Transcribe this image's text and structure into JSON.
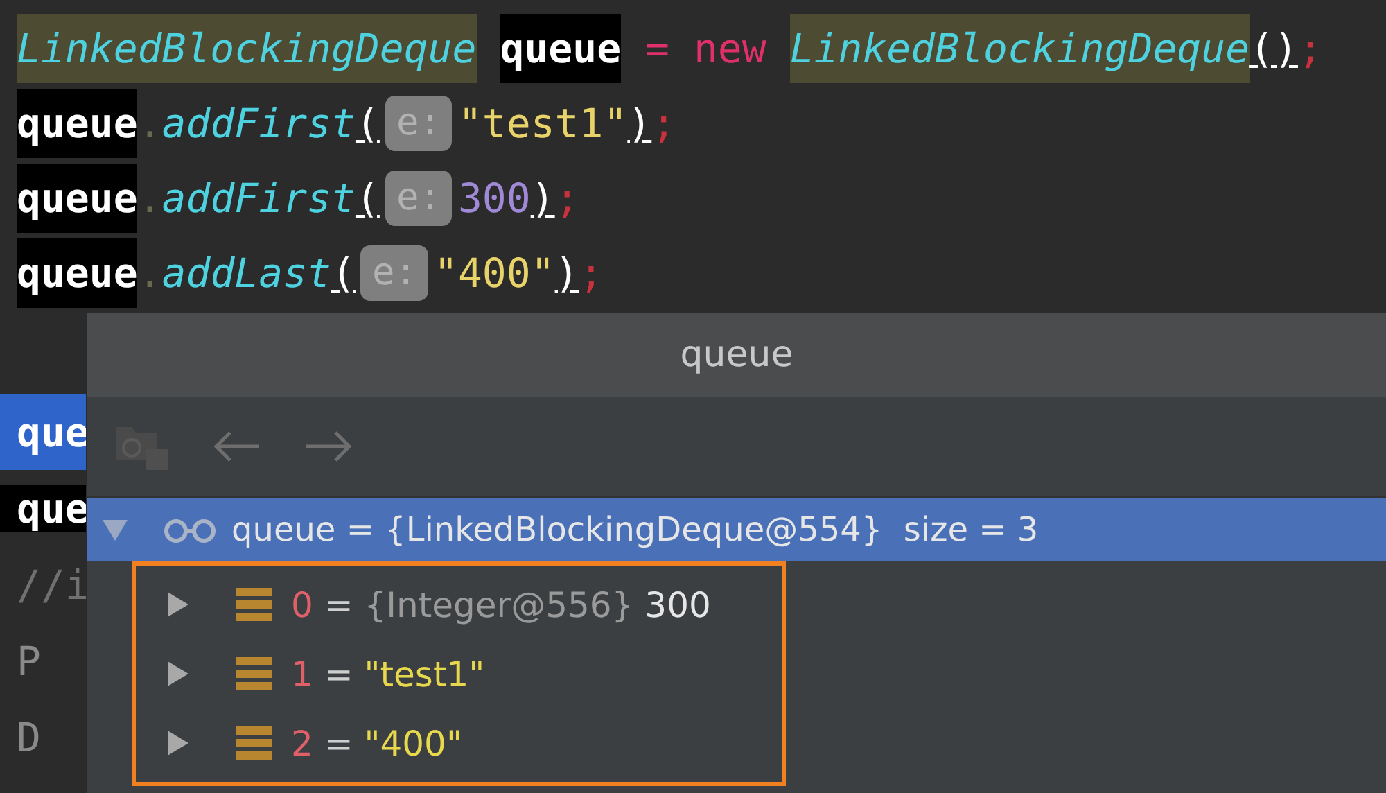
{
  "editor": {
    "lines": [
      {
        "tokens": [
          {
            "text": "LinkedBlockingDeque",
            "kind": "type"
          },
          {
            "text": "queue",
            "kind": "var"
          },
          {
            "text": " = ",
            "kind": "op"
          },
          {
            "text": "new",
            "kind": "keyword"
          },
          {
            "text": "LinkedBlockingDeque",
            "kind": "type"
          },
          {
            "text": "()",
            "kind": "paren"
          },
          {
            "text": ";",
            "kind": "semi"
          }
        ]
      },
      {
        "tokens": [
          {
            "text": "queue",
            "kind": "var"
          },
          {
            "text": ".",
            "kind": "dot"
          },
          {
            "text": "addFirst",
            "kind": "method"
          },
          {
            "text": "(",
            "kind": "paren"
          },
          {
            "text": "e:",
            "kind": "hint"
          },
          {
            "text": "\"test1\"",
            "kind": "string"
          },
          {
            "text": ")",
            "kind": "paren"
          },
          {
            "text": ";",
            "kind": "semi"
          }
        ]
      },
      {
        "tokens": [
          {
            "text": "queue",
            "kind": "var"
          },
          {
            "text": ".",
            "kind": "dot"
          },
          {
            "text": "addFirst",
            "kind": "method"
          },
          {
            "text": "(",
            "kind": "paren"
          },
          {
            "text": "e:",
            "kind": "hint"
          },
          {
            "text": "300",
            "kind": "number"
          },
          {
            "text": ")",
            "kind": "paren"
          },
          {
            "text": ";",
            "kind": "semi"
          }
        ]
      },
      {
        "tokens": [
          {
            "text": "queue",
            "kind": "var"
          },
          {
            "text": ".",
            "kind": "dot"
          },
          {
            "text": "addLast",
            "kind": "method"
          },
          {
            "text": "(",
            "kind": "paren"
          },
          {
            "text": "e:",
            "kind": "hint"
          },
          {
            "text": "\"400\"",
            "kind": "string"
          },
          {
            "text": ")",
            "kind": "paren"
          },
          {
            "text": ";",
            "kind": "semi"
          }
        ]
      }
    ]
  },
  "hidden_lines": [
    {
      "text": "que",
      "kind": "var",
      "selected": true
    },
    {
      "text": "que",
      "kind": "var",
      "selected": false
    },
    {
      "text": "//i",
      "kind": "comment",
      "selected": false
    },
    {
      "text": "P",
      "kind": "code",
      "selected": false
    },
    {
      "text": "D",
      "kind": "code",
      "selected": false
    }
  ],
  "popup": {
    "title": "queue",
    "root": {
      "name": "queue",
      "equals": "=",
      "value": "{LinkedBlockingDeque@554}",
      "size": "size = 3",
      "expanded": true,
      "selected": true,
      "children": [
        {
          "index": "0",
          "equals": "=",
          "ref": "{Integer@556}",
          "value": "300",
          "kind": "object",
          "expanded": false
        },
        {
          "index": "1",
          "equals": "=",
          "value": "\"test1\"",
          "kind": "string",
          "expanded": false
        },
        {
          "index": "2",
          "equals": "=",
          "value": "\"400\"",
          "kind": "string",
          "expanded": false
        }
      ]
    }
  }
}
